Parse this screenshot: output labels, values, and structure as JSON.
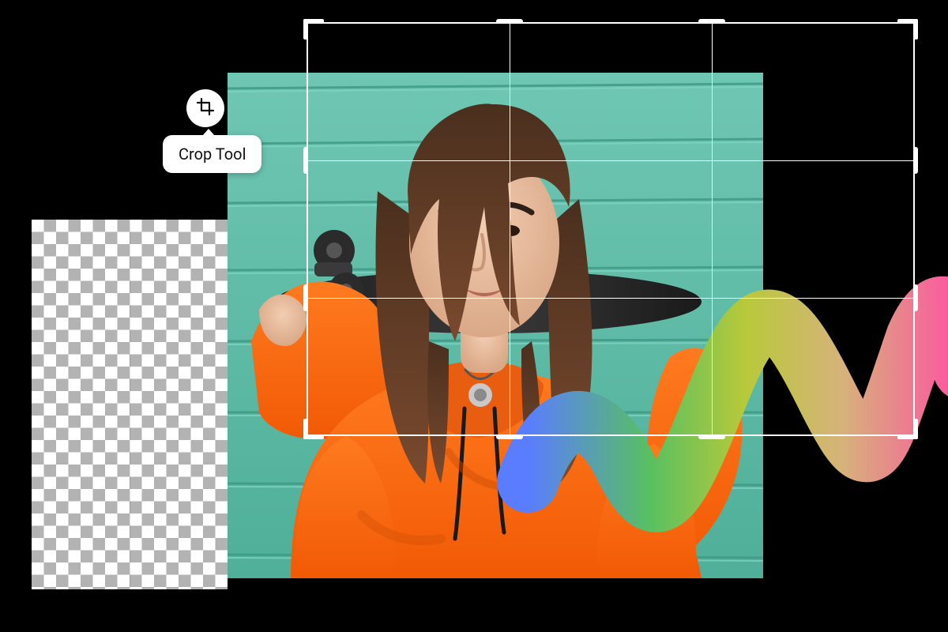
{
  "tool": {
    "icon_name": "crop-icon",
    "tooltip_label": "Crop Tool"
  },
  "colors": {
    "background": "#000000",
    "overlay_stroke": "#ffffff",
    "gradient_stops": [
      "#5a7dff",
      "#58c061",
      "#b8c93a",
      "#d6b37a",
      "#ff4fa3"
    ]
  }
}
